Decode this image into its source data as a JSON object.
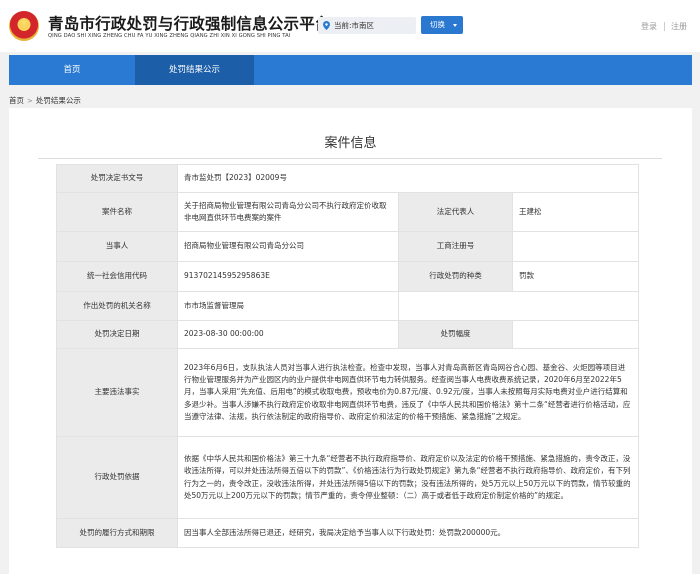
{
  "header": {
    "title": "青岛市行政处罚与行政强制信息公示平台",
    "subtitle": "QING DAO SHI XING ZHENG CHU FA YU XING ZHENG QIANG ZHI XIN XI GONG SHI PING TAI",
    "location_label": "当前:市南区",
    "switch_label": "切换",
    "login_label": "登录",
    "register_label": "注册"
  },
  "nav": {
    "home": "首页",
    "public": "处罚结果公示"
  },
  "breadcrumb": {
    "home": "首页",
    "current": "处罚结果公示"
  },
  "card": {
    "title": "案件信息"
  },
  "case": {
    "doc_no_label": "处罚决定书文号",
    "doc_no": "青市监处罚【2023】02009号",
    "case_name_label": "案件名称",
    "case_name": "关于招商局物业管理有限公司青岛分公司不执行政府定价收取非电网直供环节电费案的案件",
    "legal_rep_label": "法定代表人",
    "legal_rep": "王建松",
    "party_label": "当事人",
    "party": "招商局物业管理有限公司青岛分公司",
    "biz_reg_label": "工商注册号",
    "biz_reg": "",
    "credit_code_label": "统一社会信用代码",
    "credit_code": "91370214595295863E",
    "penalty_type_label": "行政处罚的种类",
    "penalty_type": "罚款",
    "authority_label": "作出处罚的机关名称",
    "authority": "市市场监督管理局",
    "date_label": "处罚决定日期",
    "date": "2023-08-30 00:00:00",
    "amount_label": "处罚幅度",
    "amount": "",
    "facts_label": "主要违法事实",
    "facts": "2023年6月6日，支队执法人员对当事人进行执法检查。检查中发现，当事人对青岛高新区青岛网谷合心园、基金谷、火炬园等项目进行物业管理服务并为产业园区内的业户提供非电网直供环节电力转供服务。经查阅当事人电费收费系统记录，2020年6月至2022年5月，当事人采用“先充值、后用电”的模式收取电费，预收电价为0.87元/度、0.92元/度，当事人未按照每月实际电费对业户进行结算和多退少补。当事人涉嫌不执行政府定价收取非电网直供环节电费，违反了《中华人民共和国价格法》第十二条“经营者进行价格活动，应当遵守法律、法规，执行依法制定的政府指导价、政府定价和法定的价格干预措施、紧急措施”之规定。",
    "basis_label": "行政处罚依据",
    "basis": "依据《中华人民共和国价格法》第三十九条“经营者不执行政府指导价、政府定价以及法定的价格干预措施、紧急措施的，责令改正，没收违法所得，可以并处违法所得五倍以下的罚款”、《价格违法行为行政处罚规定》第九条“经营者不执行政府指导价、政府定价，有下列行为之一的，责令改正，没收违法所得，并处违法所得5倍以下的罚款；没有违法所得的，处5万元以上50万元以下的罚款，情节较重的处50万元以上200万元以下的罚款；情节严重的，责令停业整顿：（二）高于或者低于政府定价制定价格的”的规定。",
    "execution_label": "处罚的履行方式和期限",
    "execution": "因当事人全部违法所得已退还，经研究，我局决定给予当事人以下行政处罚：处罚款200000元。"
  }
}
